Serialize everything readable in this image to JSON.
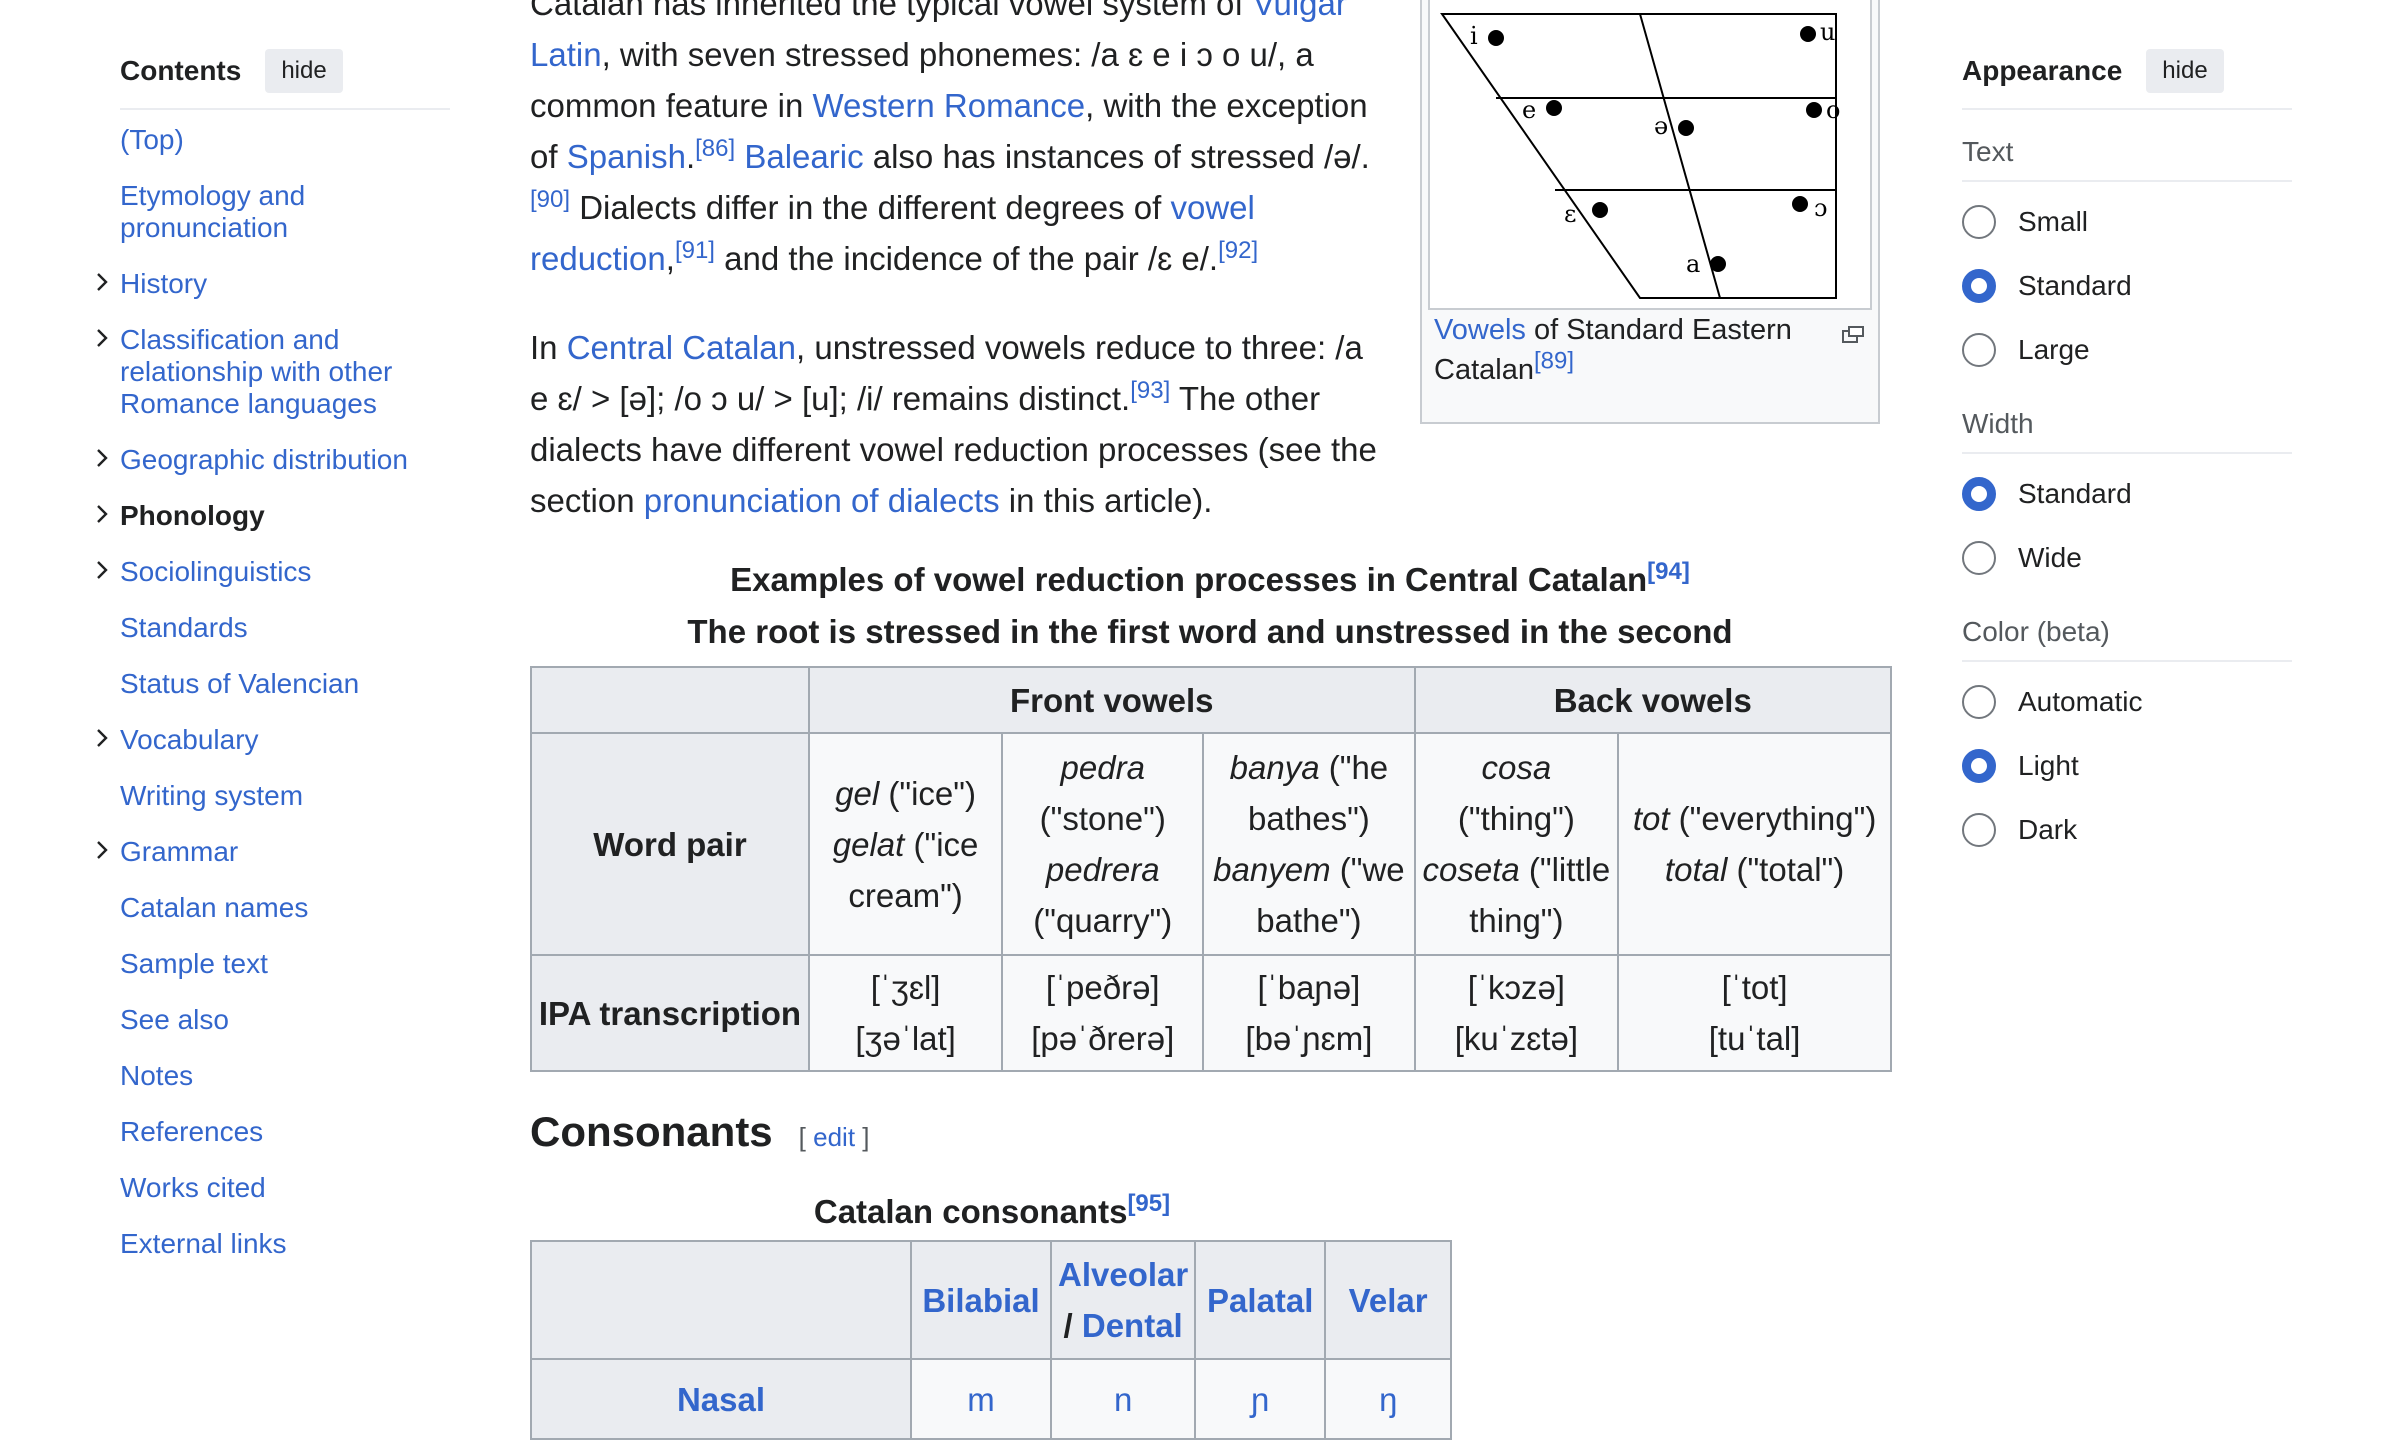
{
  "toc": {
    "title": "Contents",
    "hide_label": "hide",
    "items": [
      {
        "label": "(Top)",
        "expandable": false,
        "active": false
      },
      {
        "label": "Etymology and pronunciation",
        "expandable": false,
        "active": false
      },
      {
        "label": "History",
        "expandable": true,
        "active": false
      },
      {
        "label": "Classification and relationship with other Romance languages",
        "expandable": true,
        "active": false
      },
      {
        "label": "Geographic distribution",
        "expandable": true,
        "active": false
      },
      {
        "label": "Phonology",
        "expandable": true,
        "active": true
      },
      {
        "label": "Sociolinguistics",
        "expandable": true,
        "active": false
      },
      {
        "label": "Standards",
        "expandable": false,
        "active": false
      },
      {
        "label": "Status of Valencian",
        "expandable": false,
        "active": false
      },
      {
        "label": "Vocabulary",
        "expandable": true,
        "active": false
      },
      {
        "label": "Writing system",
        "expandable": false,
        "active": false
      },
      {
        "label": "Grammar",
        "expandable": true,
        "active": false
      },
      {
        "label": "Catalan names",
        "expandable": false,
        "active": false
      },
      {
        "label": "Sample text",
        "expandable": false,
        "active": false
      },
      {
        "label": "See also",
        "expandable": false,
        "active": false
      },
      {
        "label": "Notes",
        "expandable": false,
        "active": false
      },
      {
        "label": "References",
        "expandable": false,
        "active": false
      },
      {
        "label": "Works cited",
        "expandable": false,
        "active": false
      },
      {
        "label": "External links",
        "expandable": false,
        "active": false
      }
    ]
  },
  "article": {
    "para1": {
      "t1": "Catalan has inherited the typical vowel system of ",
      "l1": "Vulgar Latin",
      "t2": ", with seven stressed phonemes: /a ɛ e i ɔ o u/, a common feature in ",
      "l2": "Western Romance",
      "t3": ", with the exception of ",
      "l3": "Spanish",
      "r1": "[86]",
      "t4": " ",
      "l4": "Balearic",
      "t5": " also has instances of stressed /ə/.",
      "r2": "[90]",
      "t6": " Dialects differ in the different degrees of ",
      "l5": "vowel reduction",
      "t7": ",",
      "r3": "[91]",
      "t8": " and the incidence of the pair /ɛ e/.",
      "r4": "[92]"
    },
    "para2": {
      "t1": "In ",
      "l1": "Central Catalan",
      "t2": ", unstressed vowels reduce to three: /a e ɛ/ > [ə]; /o ɔ u/ > [u]; /i/ remains distinct.",
      "r1": "[93]",
      "t3": " The other dialects have different vowel reduction processes (see the section ",
      "l2": "pronunciation of dialects",
      "t4": " in this article)."
    },
    "figure": {
      "caption_link": "Vowels",
      "caption_text": " of Standard Eastern Catalan",
      "caption_ref": "[89]",
      "vowel_labels": [
        "i",
        "u",
        "e",
        "ə",
        "o",
        "ɛ",
        "ɔ",
        "a"
      ]
    },
    "vowel_table": {
      "caption1": "Examples of vowel reduction processes in Central Catalan",
      "caption1_ref": "[94]",
      "caption2": "The root is stressed in the first word and unstressed in the second",
      "group_front": "Front vowels",
      "group_back": "Back vowels",
      "row_word_header": "Word pair",
      "row_ipa_header": "IPA transcription",
      "cols": [
        {
          "w1": "gel",
          "g1": " (\"ice\")",
          "w2": "gelat",
          "g2": " (\"ice cream\")",
          "ipa1": "[ˈʒɛl]",
          "ipa2": "[ʒəˈlat]"
        },
        {
          "w1": "pedra",
          "g1": " (\"stone\")",
          "w2": "pedrera",
          "g2": " (\"quarry\")",
          "ipa1": "[ˈpeðrə]",
          "ipa2": "[pəˈðrerə]"
        },
        {
          "w1": "banya",
          "g1": " (\"he bathes\")",
          "w2": "banyem",
          "g2": " (\"we bathe\")",
          "ipa1": "[ˈbaɲə]",
          "ipa2": "[bəˈɲɛm]"
        },
        {
          "w1": "cosa",
          "g1": " (\"thing\")",
          "w2": "coseta",
          "g2": " (\"little thing\")",
          "ipa1": "[ˈkɔzə]",
          "ipa2": "[kuˈzɛtə]"
        },
        {
          "w1": "tot",
          "g1": " (\"everything\")",
          "w2": "total",
          "g2": " (\"total\")",
          "ipa1": "[ˈtot]",
          "ipa2": "[tuˈtal]"
        }
      ]
    },
    "consonants": {
      "heading": "Consonants",
      "edit_label": "edit",
      "caption": "Catalan consonants",
      "caption_ref": "[95]",
      "col_bilabial": "Bilabial",
      "col_alveolar": "Alveolar",
      "col_dental": "Dental",
      "col_palatal": "Palatal",
      "col_velar": "Velar",
      "row_nasal": "Nasal",
      "nasal_cells": [
        "m",
        "n",
        "ɲ",
        "ŋ"
      ]
    }
  },
  "appearance": {
    "title": "Appearance",
    "hide_label": "hide",
    "text_label": "Text",
    "text_options": [
      "Small",
      "Standard",
      "Large"
    ],
    "text_selected": "Standard",
    "width_label": "Width",
    "width_options": [
      "Standard",
      "Wide"
    ],
    "width_selected": "Standard",
    "color_label": "Color (beta)",
    "color_options": [
      "Automatic",
      "Light",
      "Dark"
    ],
    "color_selected": "Light"
  },
  "colors": {
    "link": "#3366cc",
    "text": "#202122",
    "radio_selected": "#3366cc",
    "border": "#a2a9b1"
  }
}
